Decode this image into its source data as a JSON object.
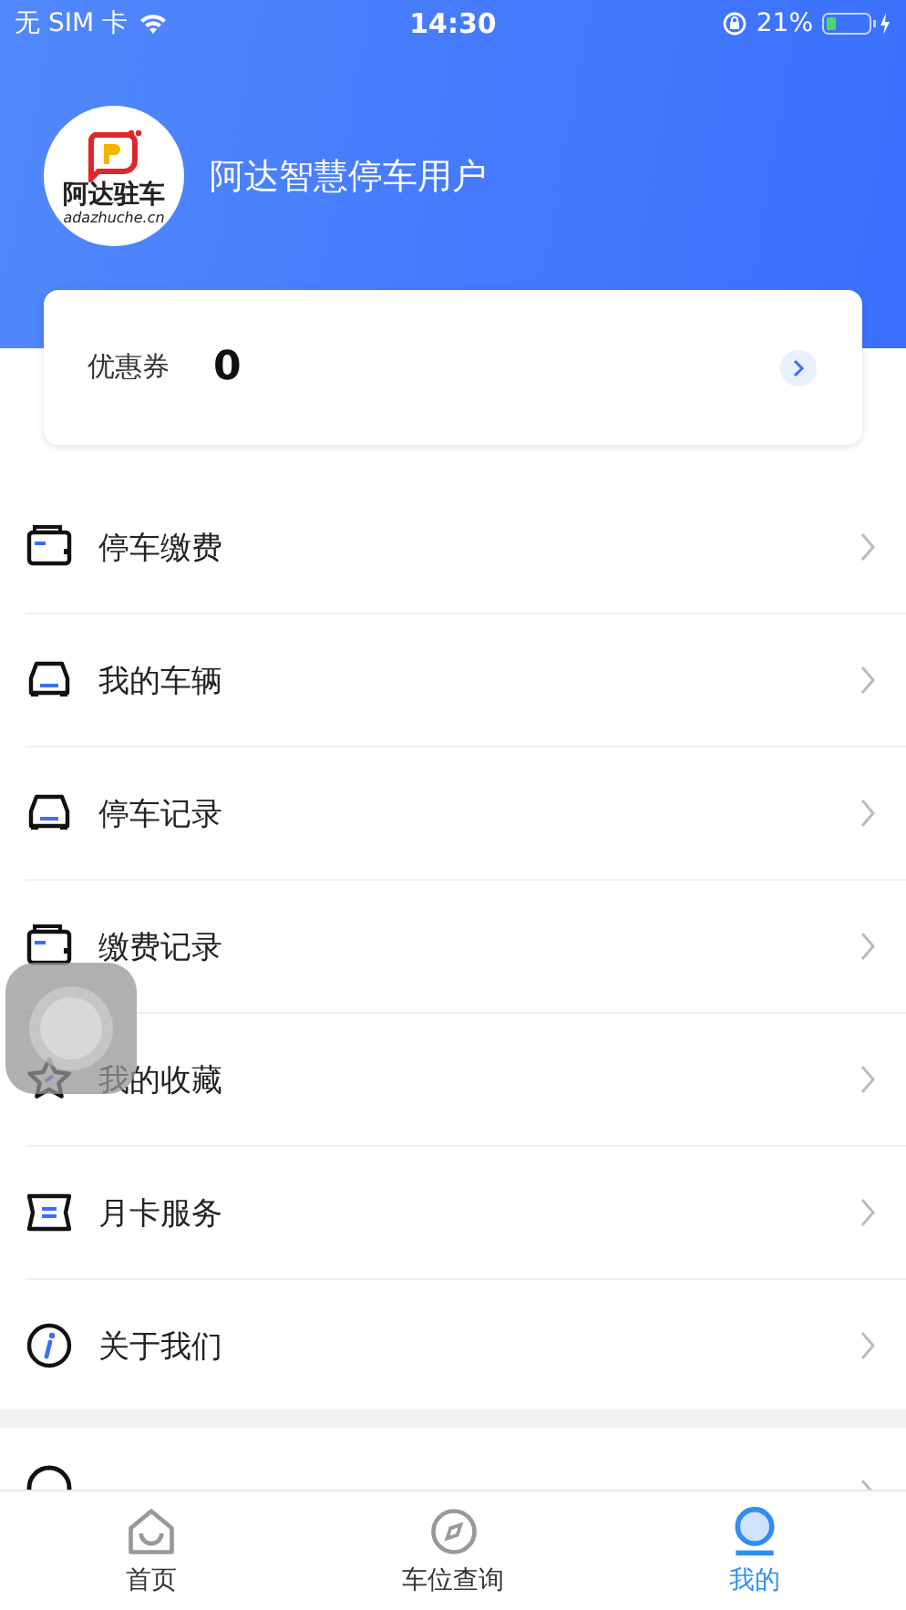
{
  "status_bar": {
    "carrier": "无 SIM 卡",
    "time": "14:30",
    "battery": "21%"
  },
  "profile": {
    "logo_text": "阿达驻车",
    "logo_url": "adazhuche.cn",
    "user_name": "阿达智慧停车用户"
  },
  "coupon": {
    "label": "优惠券",
    "count": "0"
  },
  "menu": [
    {
      "kind": "wallet",
      "label": "停车缴费"
    },
    {
      "kind": "car",
      "label": "我的车辆"
    },
    {
      "kind": "car",
      "label": "停车记录"
    },
    {
      "kind": "wallet",
      "label": "缴费记录"
    },
    {
      "kind": "star",
      "label": "我的收藏"
    },
    {
      "kind": "ticket",
      "label": "月卡服务"
    },
    {
      "kind": "info",
      "label": "关于我们"
    },
    {
      "kind": "headset",
      "group_break": true
    }
  ],
  "tabs": [
    {
      "kind": "home",
      "label": "首页",
      "selected": false
    },
    {
      "kind": "compass",
      "label": "车位查询",
      "selected": false
    },
    {
      "kind": "profile",
      "label": "我的",
      "selected": true
    }
  ]
}
